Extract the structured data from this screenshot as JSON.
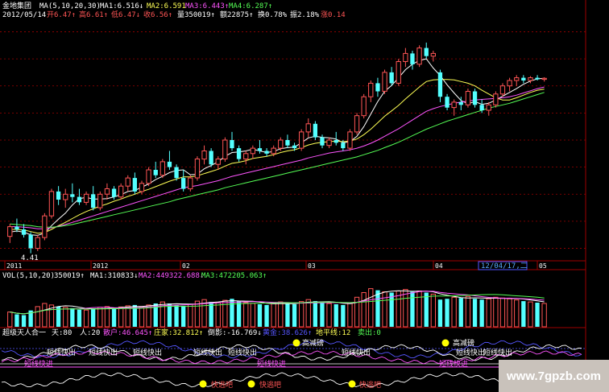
{
  "header": {
    "stock_name": "金地集团",
    "ma_label": "MA(5,10,20,30)",
    "ma1": "MA1:6.516↓",
    "ma2": "MA2:6.591",
    "ma3": "MA3:6.443↑",
    "ma4": "MA4:6.287↑",
    "date": "2012/05/14",
    "open": "开6.47↑",
    "high": "高6.61↑",
    "low": "低6.47↓",
    "close": "收6.56↑",
    "volume": "量350019↑",
    "amount": "额22875↑",
    "turnover": "换0.78%",
    "amplitude": "振2.18%",
    "rise": "涨0.14"
  },
  "time_axis": {
    "labels": [
      "2011",
      "2012",
      "02",
      "03",
      "04",
      "05"
    ],
    "cursor": "12/04/17,二"
  },
  "volume_panel": {
    "label": "VOL(5,10,20)",
    "current": "350019↑",
    "ma1": "MA1:310833↓",
    "ma2": "MA2:449322.688↓",
    "ma3": "MA3:472205.063↑"
  },
  "indicator_panel": {
    "name": "超级天人合一",
    "tian": "天:80",
    "ren": "人:20",
    "sanhu": "散户:46.645↑",
    "zhuangjia": "庄家:32.812↑",
    "daoying": "倒影:-16.769↓",
    "huangjin": "黄金:38.626↑",
    "dipingxian": "地平线:12",
    "maichu": "卖出:0",
    "signals": {
      "short_out": "短线快出",
      "short_in": "短线快进",
      "high_buy": "高减磅",
      "escape": "快逃吧"
    }
  },
  "watermark": "www.7gpzb.com",
  "colors": {
    "up_candle": "#ff5555",
    "down_candle": "#54ffff",
    "ma1": "#ffffff",
    "ma2": "#ffff55",
    "ma3": "#ff55ff",
    "ma4": "#55ff55",
    "grid": "#a00000"
  },
  "chart_data": [
    {
      "type": "candlestick",
      "title": "金地集团 MA(5,10,20,30)",
      "annotations": [
        "4.41"
      ],
      "ohlc": [
        [
          4.72,
          4.95,
          4.6,
          4.9
        ],
        [
          4.9,
          5.05,
          4.8,
          4.85
        ],
        [
          4.85,
          4.95,
          4.7,
          4.75
        ],
        [
          4.75,
          4.8,
          4.41,
          4.5
        ],
        [
          4.5,
          4.75,
          4.45,
          4.7
        ],
        [
          4.7,
          5.15,
          4.65,
          5.1
        ],
        [
          5.1,
          5.6,
          5.05,
          5.55
        ],
        [
          5.55,
          5.65,
          5.3,
          5.4
        ],
        [
          5.4,
          5.6,
          5.25,
          5.5
        ],
        [
          5.5,
          5.7,
          5.35,
          5.45
        ],
        [
          5.45,
          5.6,
          5.3,
          5.35
        ],
        [
          5.35,
          5.55,
          5.3,
          5.5
        ],
        [
          5.5,
          5.65,
          5.2,
          5.25
        ],
        [
          5.25,
          5.55,
          5.2,
          5.5
        ],
        [
          5.5,
          5.7,
          5.4,
          5.6
        ],
        [
          5.6,
          5.65,
          5.4,
          5.45
        ],
        [
          5.45,
          5.7,
          5.4,
          5.65
        ],
        [
          5.65,
          5.85,
          5.55,
          5.8
        ],
        [
          5.8,
          5.9,
          5.5,
          5.55
        ],
        [
          5.55,
          5.75,
          5.5,
          5.7
        ],
        [
          5.7,
          6.0,
          5.65,
          5.95
        ],
        [
          5.95,
          6.1,
          5.8,
          5.85
        ],
        [
          5.85,
          6.15,
          5.8,
          6.1
        ],
        [
          6.1,
          6.3,
          5.95,
          6.0
        ],
        [
          6.0,
          6.05,
          5.75,
          5.8
        ],
        [
          5.8,
          5.95,
          5.55,
          5.6
        ],
        [
          5.6,
          5.85,
          5.55,
          5.8
        ],
        [
          5.8,
          6.2,
          5.75,
          6.15
        ],
        [
          6.15,
          6.4,
          6.05,
          6.3
        ],
        [
          6.3,
          6.35,
          6.0,
          6.05
        ],
        [
          6.05,
          6.2,
          5.95,
          6.15
        ],
        [
          6.15,
          6.55,
          6.1,
          6.5
        ],
        [
          6.5,
          6.65,
          6.3,
          6.35
        ],
        [
          6.35,
          6.4,
          6.1,
          6.15
        ],
        [
          6.15,
          6.3,
          6.05,
          6.25
        ],
        [
          6.25,
          6.4,
          6.15,
          6.35
        ],
        [
          6.35,
          6.5,
          6.25,
          6.3
        ],
        [
          6.3,
          6.35,
          6.2,
          6.25
        ],
        [
          6.25,
          6.4,
          6.2,
          6.35
        ],
        [
          6.35,
          6.55,
          6.3,
          6.5
        ],
        [
          6.5,
          6.6,
          6.35,
          6.4
        ],
        [
          6.4,
          6.45,
          6.3,
          6.35
        ],
        [
          6.35,
          6.7,
          6.3,
          6.65
        ],
        [
          6.65,
          6.9,
          6.55,
          6.8
        ],
        [
          6.8,
          6.85,
          6.5,
          6.55
        ],
        [
          6.55,
          6.6,
          6.35,
          6.4
        ],
        [
          6.4,
          6.55,
          6.35,
          6.5
        ],
        [
          6.5,
          6.65,
          6.4,
          6.45
        ],
        [
          6.45,
          6.5,
          6.3,
          6.35
        ],
        [
          6.35,
          6.7,
          6.3,
          6.65
        ],
        [
          6.65,
          7.0,
          6.6,
          6.95
        ],
        [
          6.95,
          7.35,
          6.9,
          7.3
        ],
        [
          7.3,
          7.6,
          7.2,
          7.55
        ],
        [
          7.55,
          7.65,
          7.3,
          7.4
        ],
        [
          7.4,
          7.8,
          7.35,
          7.75
        ],
        [
          7.75,
          7.85,
          7.5,
          7.55
        ],
        [
          7.55,
          8.0,
          7.5,
          7.95
        ],
        [
          7.95,
          8.2,
          7.85,
          8.1
        ],
        [
          8.1,
          8.15,
          7.8,
          7.9
        ],
        [
          7.9,
          8.25,
          7.85,
          8.2
        ],
        [
          8.2,
          8.3,
          8.0,
          8.05
        ],
        [
          8.05,
          8.15,
          7.95,
          8.1
        ],
        [
          7.75,
          7.8,
          7.2,
          7.3
        ],
        [
          7.3,
          7.35,
          7.05,
          7.1
        ],
        [
          7.1,
          7.25,
          6.95,
          7.2
        ],
        [
          7.2,
          7.3,
          7.05,
          7.15
        ],
        [
          7.15,
          7.45,
          7.1,
          7.4
        ],
        [
          7.4,
          7.45,
          7.1,
          7.15
        ],
        [
          7.15,
          7.25,
          7.0,
          7.05
        ],
        [
          7.05,
          7.2,
          6.95,
          7.15
        ],
        [
          7.15,
          7.4,
          7.1,
          7.35
        ],
        [
          7.35,
          7.55,
          7.3,
          7.5
        ],
        [
          7.5,
          7.65,
          7.4,
          7.6
        ],
        [
          7.6,
          7.7,
          7.5,
          7.65
        ],
        [
          7.65,
          7.7,
          7.55,
          7.6
        ],
        [
          7.6,
          7.68,
          7.55,
          7.65
        ],
        [
          7.65,
          7.7,
          7.6,
          7.62
        ],
        [
          7.62,
          7.66,
          7.58,
          7.64
        ]
      ],
      "ma": [
        {
          "name": "MA1",
          "values": [
            4.8,
            4.82,
            4.8,
            4.75,
            4.74,
            4.78,
            4.92,
            5.04,
            5.15,
            5.3,
            5.42,
            5.44,
            5.41,
            5.41,
            5.42,
            5.45,
            5.49,
            5.55,
            5.57,
            5.63,
            5.69,
            5.77,
            5.83,
            5.9,
            5.94,
            5.95,
            5.86,
            5.87,
            5.97,
            6.03,
            6.1,
            6.2,
            6.27,
            6.28,
            6.3,
            6.33,
            6.3,
            6.27,
            6.29,
            6.34,
            6.36,
            6.37,
            6.45,
            6.54,
            6.57,
            6.55,
            6.54,
            6.52,
            6.45,
            6.47,
            6.57,
            6.75,
            6.98,
            7.21,
            7.4,
            7.51,
            7.65,
            7.8,
            7.9,
            7.97,
            8.0,
            7.83,
            7.69,
            7.52,
            7.37,
            7.23,
            7.17,
            7.21,
            7.16,
            7.18,
            7.24,
            7.31,
            7.38,
            7.45,
            7.53,
            7.59,
            7.63,
            7.64
          ]
        },
        {
          "name": "MA2",
          "values": [
            4.85,
            4.85,
            4.84,
            4.81,
            4.78,
            4.79,
            4.85,
            4.92,
            4.98,
            5.05,
            5.12,
            5.18,
            5.23,
            5.28,
            5.32,
            5.37,
            5.41,
            5.46,
            5.5,
            5.55,
            5.59,
            5.64,
            5.69,
            5.74,
            5.78,
            5.82,
            5.82,
            5.84,
            5.88,
            5.92,
            5.96,
            6.02,
            6.07,
            6.09,
            6.12,
            6.16,
            6.18,
            6.2,
            6.23,
            6.27,
            6.3,
            6.32,
            6.36,
            6.41,
            6.44,
            6.46,
            6.47,
            6.48,
            6.47,
            6.48,
            6.52,
            6.6,
            6.7,
            6.82,
            6.94,
            7.04,
            7.14,
            7.26,
            7.37,
            7.48,
            7.58,
            7.61,
            7.62,
            7.62,
            7.61,
            7.58,
            7.55,
            7.5,
            7.42,
            7.35,
            7.28,
            7.24,
            7.24,
            7.28,
            7.33,
            7.38,
            7.42,
            7.44
          ]
        },
        {
          "name": "MA3",
          "values": [
            4.9,
            4.9,
            4.89,
            4.88,
            4.86,
            4.86,
            4.88,
            4.91,
            4.94,
            4.98,
            5.02,
            5.06,
            5.1,
            5.14,
            5.18,
            5.22,
            5.26,
            5.3,
            5.34,
            5.38,
            5.42,
            5.46,
            5.5,
            5.54,
            5.58,
            5.62,
            5.64,
            5.66,
            5.69,
            5.72,
            5.75,
            5.79,
            5.83,
            5.86,
            5.89,
            5.92,
            5.95,
            5.98,
            6.01,
            6.04,
            6.07,
            6.1,
            6.13,
            6.17,
            6.2,
            6.23,
            6.26,
            6.28,
            6.3,
            6.32,
            6.35,
            6.39,
            6.44,
            6.5,
            6.57,
            6.64,
            6.71,
            6.79,
            6.87,
            6.95,
            7.03,
            7.08,
            7.12,
            7.15,
            7.18,
            7.2,
            7.22,
            7.24,
            7.25,
            7.26,
            7.27,
            7.28,
            7.3,
            7.33,
            7.37,
            7.41,
            7.45,
            7.48
          ]
        },
        {
          "name": "MA4",
          "values": [
            4.95,
            4.94,
            4.93,
            4.92,
            4.9,
            4.89,
            4.89,
            4.9,
            4.92,
            4.94,
            4.97,
            5.0,
            5.03,
            5.06,
            5.09,
            5.12,
            5.15,
            5.18,
            5.21,
            5.24,
            5.27,
            5.3,
            5.33,
            5.36,
            5.4,
            5.43,
            5.46,
            5.49,
            5.52,
            5.55,
            5.58,
            5.62,
            5.65,
            5.68,
            5.71,
            5.74,
            5.77,
            5.8,
            5.83,
            5.86,
            5.89,
            5.92,
            5.95,
            5.98,
            6.01,
            6.04,
            6.07,
            6.1,
            6.13,
            6.16,
            6.19,
            6.23,
            6.27,
            6.31,
            6.36,
            6.41,
            6.46,
            6.52,
            6.58,
            6.64,
            6.7,
            6.75,
            6.8,
            6.85,
            6.89,
            6.93,
            6.97,
            7.01,
            7.05,
            7.09,
            7.12,
            7.15,
            7.18,
            7.22,
            7.26,
            7.3,
            7.34,
            7.38
          ]
        }
      ],
      "ylim": [
        4.3,
        8.7
      ]
    },
    {
      "type": "bar",
      "title": "VOL(5,10,20)",
      "values": [
        380,
        320,
        300,
        420,
        520,
        600,
        560,
        520,
        500,
        480,
        440,
        430,
        470,
        500,
        520,
        480,
        510,
        540,
        560,
        520,
        560,
        600,
        640,
        600,
        560,
        540,
        580,
        660,
        700,
        640,
        620,
        680,
        720,
        660,
        620,
        600,
        580,
        560,
        600,
        640,
        600,
        580,
        650,
        700,
        660,
        620,
        600,
        580,
        560,
        620,
        760,
        880,
        980,
        940,
        900,
        880,
        920,
        960,
        900,
        920,
        880,
        840,
        700,
        720,
        760,
        740,
        780,
        720,
        700,
        720,
        760,
        740,
        720,
        690,
        660,
        640,
        620,
        600
      ],
      "ylim": [
        0,
        1200
      ]
    }
  ]
}
